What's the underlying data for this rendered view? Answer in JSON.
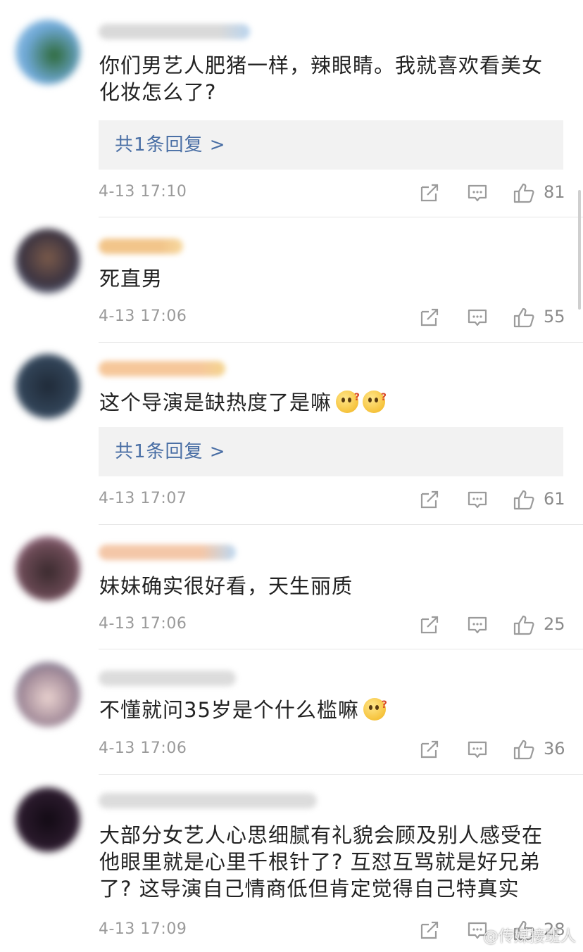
{
  "comments": [
    {
      "text": "你们男艺人肥猪一样，辣眼睛。我就喜欢看美女化妆怎么了?",
      "reply_label": "共1条回复 >",
      "time": "4-13 17:10",
      "likes": "81"
    },
    {
      "text": "死直男",
      "time": "4-13 17:06",
      "likes": "55"
    },
    {
      "text": "这个导演是缺热度了是嘛",
      "reply_label": "共1条回复 >",
      "time": "4-13 17:07",
      "likes": "61"
    },
    {
      "text": "妹妹确实很好看，天生丽质",
      "time": "4-13 17:06",
      "likes": "25"
    },
    {
      "text": "不懂就问35岁是个什么槛嘛",
      "time": "4-13 17:06",
      "likes": "36"
    },
    {
      "text": "大部分女艺人心思细腻有礼貌会顾及别人感受在他眼里就是心里千根针了? 互怼互骂就是好兄弟了? 这导演自己情商低但肯定觉得自己特真实",
      "time": "4-13 17:09",
      "likes": "28"
    }
  ],
  "watermark": "@传媒接班人",
  "icons": {
    "share": "share-icon",
    "reply": "comment-icon",
    "like": "thumbs-up-icon",
    "emoji": "confused-face-emoji"
  },
  "colors": {
    "reply_link": "#4a6fa5",
    "meta_text": "#9a9a9a",
    "reply_box_bg": "#f2f2f2"
  }
}
